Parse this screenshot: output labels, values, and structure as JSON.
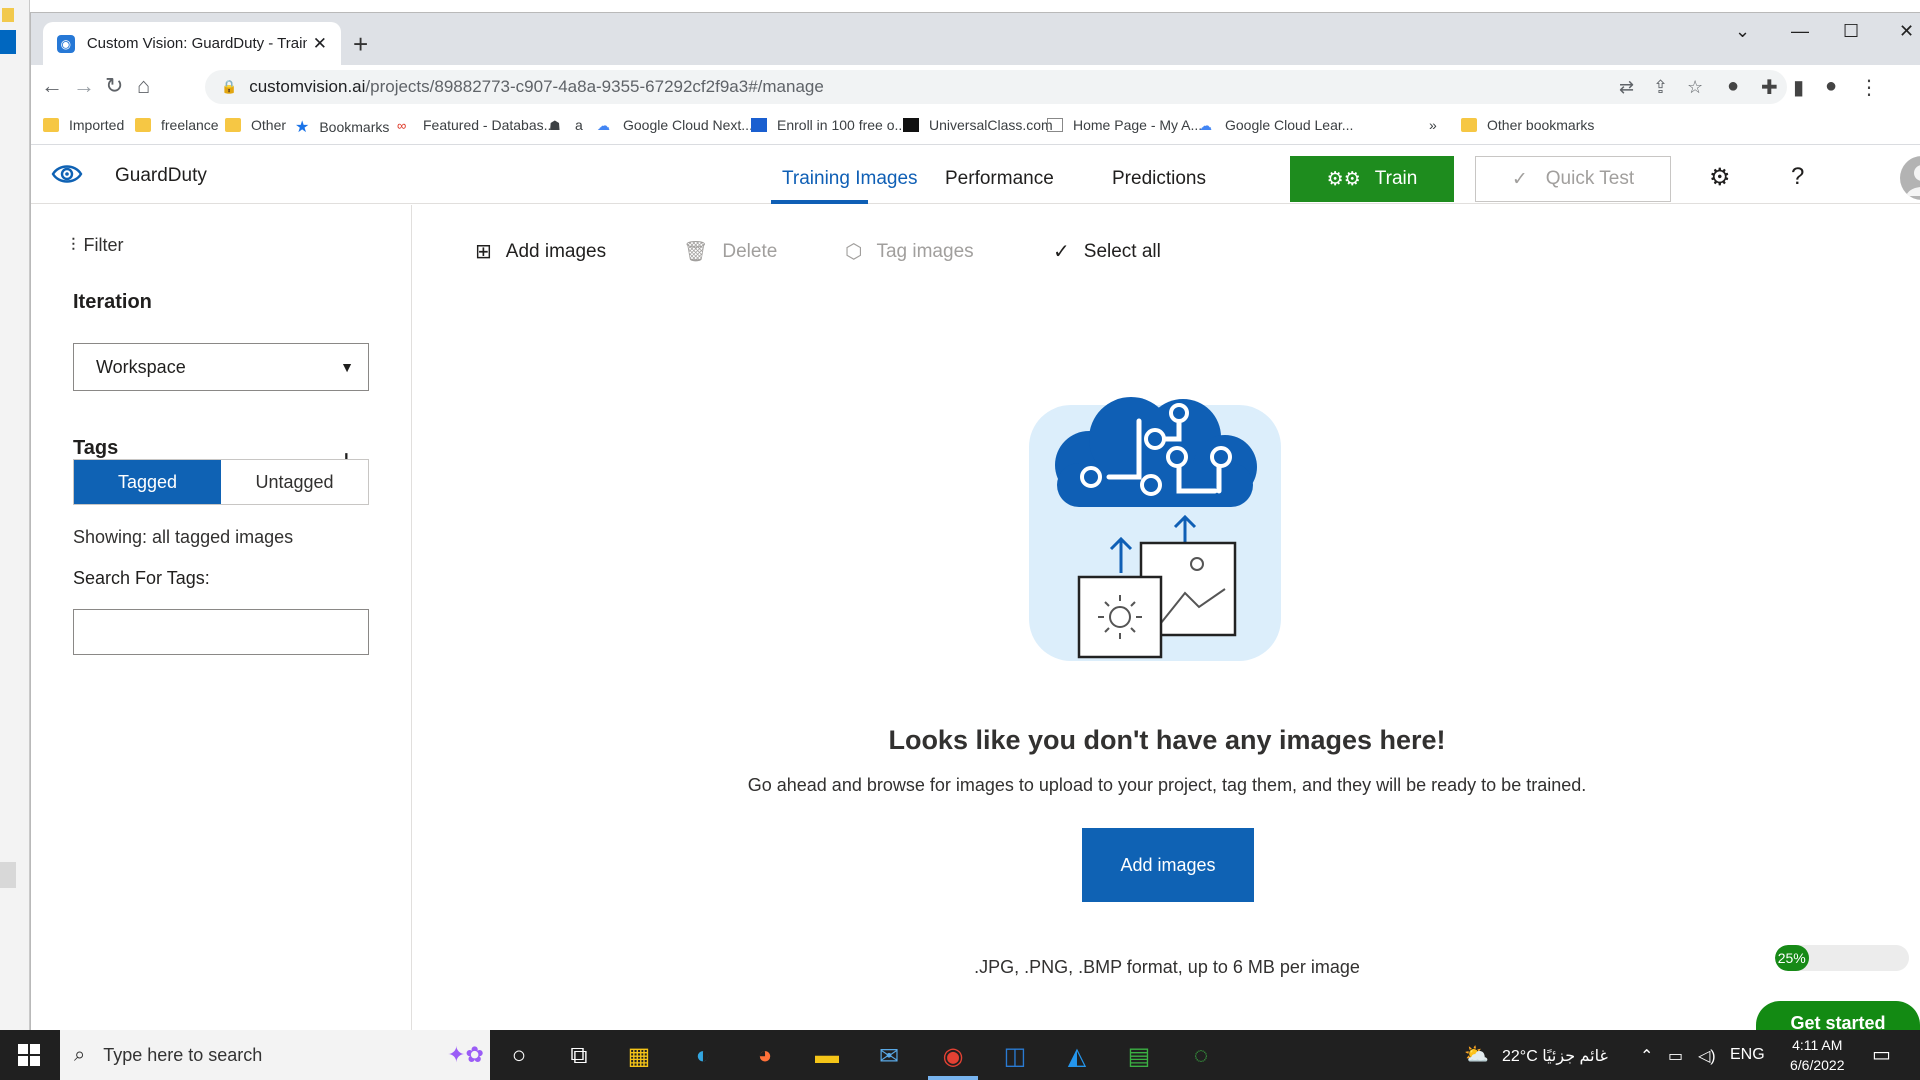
{
  "browser": {
    "tab_title": "Custom Vision: GuardDuty - Training Images",
    "tab_close": "✕",
    "new_tab": "+",
    "url_host": "customvision.ai",
    "url_path": "/projects/89882773-c907-4a8a-9355-67292cf2f9a3#/manage"
  },
  "bookmarks": [
    {
      "label": "Imported",
      "icon": "folder-icon"
    },
    {
      "label": "freelance",
      "icon": "folder-icon"
    },
    {
      "label": "Other",
      "icon": "folder-icon"
    },
    {
      "label": "Bookmarks",
      "icon": "star-icon"
    },
    {
      "label": "Featured - Databas...",
      "icon": "site-icon"
    },
    {
      "label": "a",
      "icon": "site-icon"
    },
    {
      "label": "Google Cloud Next...",
      "icon": "google-cloud-icon"
    },
    {
      "label": "Enroll in 100 free o...",
      "icon": "site-icon"
    },
    {
      "label": "UniversalClass.com",
      "icon": "site-icon"
    },
    {
      "label": "Home Page - My A...",
      "icon": "site-icon"
    },
    {
      "label": "Google Cloud Lear...",
      "icon": "google-cloud-icon"
    },
    {
      "label": "»",
      "icon": "overflow"
    },
    {
      "label": "Other bookmarks",
      "icon": "folder-icon"
    }
  ],
  "app": {
    "name": "GuardDuty",
    "nav": [
      "Training Images",
      "Performance",
      "Predictions"
    ],
    "train_label": "Train",
    "quick_test_label": "Quick Test"
  },
  "sidebar": {
    "filter_label": "Filter",
    "iteration_heading": "Iteration",
    "iteration_value": "Workspace",
    "tags_heading": "Tags",
    "tagged_label": "Tagged",
    "untagged_label": "Untagged",
    "showing_text": "Showing: all tagged images",
    "search_label": "Search For Tags:",
    "search_value": ""
  },
  "toolbar": {
    "add_images": "Add images",
    "delete": "Delete",
    "tag_images": "Tag images",
    "select_all": "Select all"
  },
  "empty_state": {
    "title": "Looks like you don't have any images here!",
    "subtitle": "Go ahead and browse for images to upload to your project, tag them, and they will be ready to be trained.",
    "button_label": "Add images",
    "formats": ".JPG, .PNG, .BMP format, up to 6 MB per image"
  },
  "onboarding": {
    "progress_percent": 25,
    "progress_label": "25%",
    "get_started_label": "Get started"
  },
  "taskbar": {
    "search_placeholder": "Type here to search",
    "weather": "22°C  غائم جزئيًا",
    "language": "ENG",
    "time": "4:11 AM",
    "date": "6/6/2022"
  },
  "colors": {
    "accent_blue": "#0f62b4",
    "train_green": "#1e8c1e"
  }
}
